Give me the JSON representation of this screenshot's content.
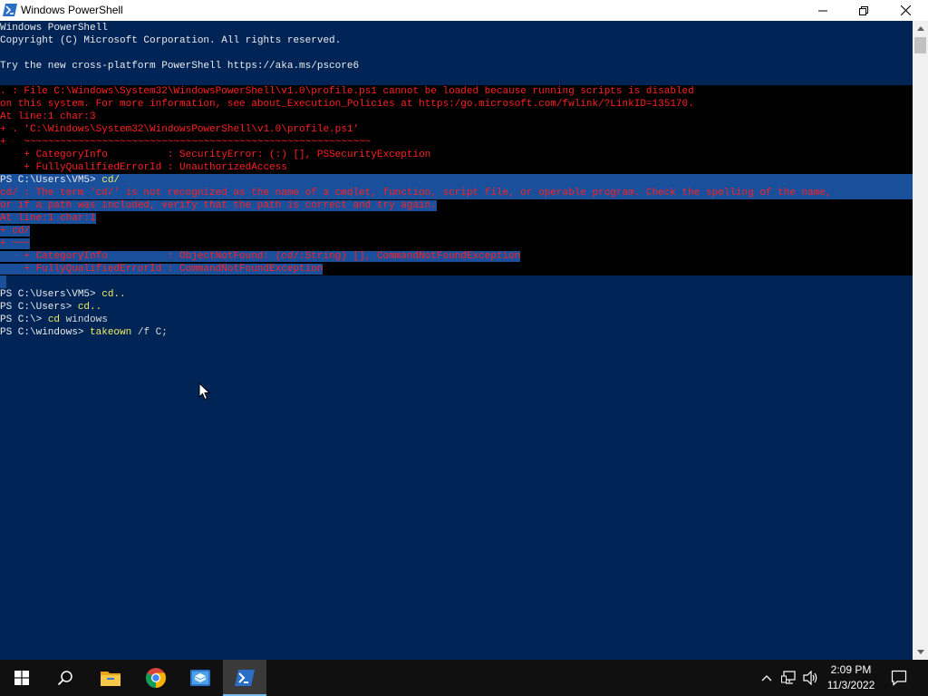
{
  "window": {
    "title": "Windows PowerShell"
  },
  "console": {
    "intro": [
      "Windows PowerShell",
      "Copyright (C) Microsoft Corporation. All rights reserved.",
      "",
      "Try the new cross-platform PowerShell https://aka.ms/pscore6",
      ""
    ],
    "profile_error": [
      ". : File C:\\Windows\\System32\\WindowsPowerShell\\v1.0\\profile.ps1 cannot be loaded because running scripts is disabled",
      "on this system. For more information, see about_Execution_Policies at https:/go.microsoft.com/fwlink/?LinkID=135170.",
      "At line:1 char:3",
      "+ . 'C:\\Windows\\System32\\WindowsPowerShell\\v1.0\\profile.ps1'",
      "+   ~~~~~~~~~~~~~~~~~~~~~~~~~~~~~~~~~~~~~~~~~~~~~~~~~~~~~~~~~~",
      "    + CategoryInfo          : SecurityError: (:) [], PSSecurityException",
      "    + FullyQualifiedErrorId : UnauthorizedAccess"
    ],
    "prompt1": "PS C:\\Users\\VM5> ",
    "cmd1": "cd/",
    "cd_error": [
      "cd/ : The term 'cd/' is not recognized as the name of a cmdlet, function, script file, or operable program. Check the spelling of the name,",
      "or if a path was included, verify that the path is correct and try again.",
      "At line:1 char:1",
      "+ cd/",
      "+ ~~~",
      "    + CategoryInfo          : ObjectNotFound: (cd/:String) [], CommandNotFoundException",
      "    + FullyQualifiedErrorId : CommandNotFoundException"
    ],
    "history": [
      {
        "prompt": "PS C:\\Users\\VM5> ",
        "cmd": "cd..",
        "arg": ""
      },
      {
        "prompt": "PS C:\\Users> ",
        "cmd": "cd..",
        "arg": ""
      },
      {
        "prompt": "PS C:\\> ",
        "cmd": "cd",
        "arg": " windows"
      },
      {
        "prompt": "PS C:\\windows> ",
        "cmd": "takeown",
        "arg": " /f C;"
      }
    ]
  },
  "taskbar": {
    "icons": [
      "windows-start-icon",
      "search-icon",
      "file-explorer-icon",
      "chrome-icon",
      "app-icon",
      "powershell-icon"
    ],
    "tray_icons": [
      "chevron-up-icon",
      "network-icon",
      "volume-icon",
      "notification-icon"
    ],
    "time": "2:09 PM",
    "date": "11/3/2022"
  },
  "colors": {
    "console_bg": "#012456",
    "console_fg": "#ececec",
    "error_fg": "#ff2020",
    "command_fg": "#f0f060",
    "selection_bg": "#1a4f9c"
  }
}
